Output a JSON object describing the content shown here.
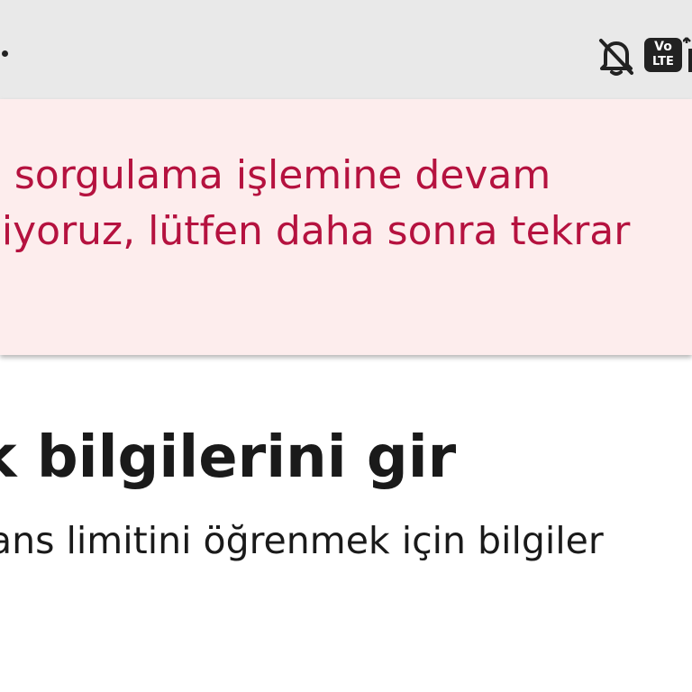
{
  "status_bar": {
    "icons": [
      "notifications-muted-icon",
      "volte-icon",
      "signal-icon"
    ],
    "volte_top": "Vo",
    "volte_bottom": "LTE"
  },
  "alert": {
    "message": "n sorgulama işlemine devam\nniyoruz, lütfen daha sonra tekrar\n.",
    "text_color": "#b5123f",
    "background": "#fdeded"
  },
  "form": {
    "title": "k bilgilerini gir",
    "subtitle": "ans limitini öğrenmek için bilgiler"
  }
}
